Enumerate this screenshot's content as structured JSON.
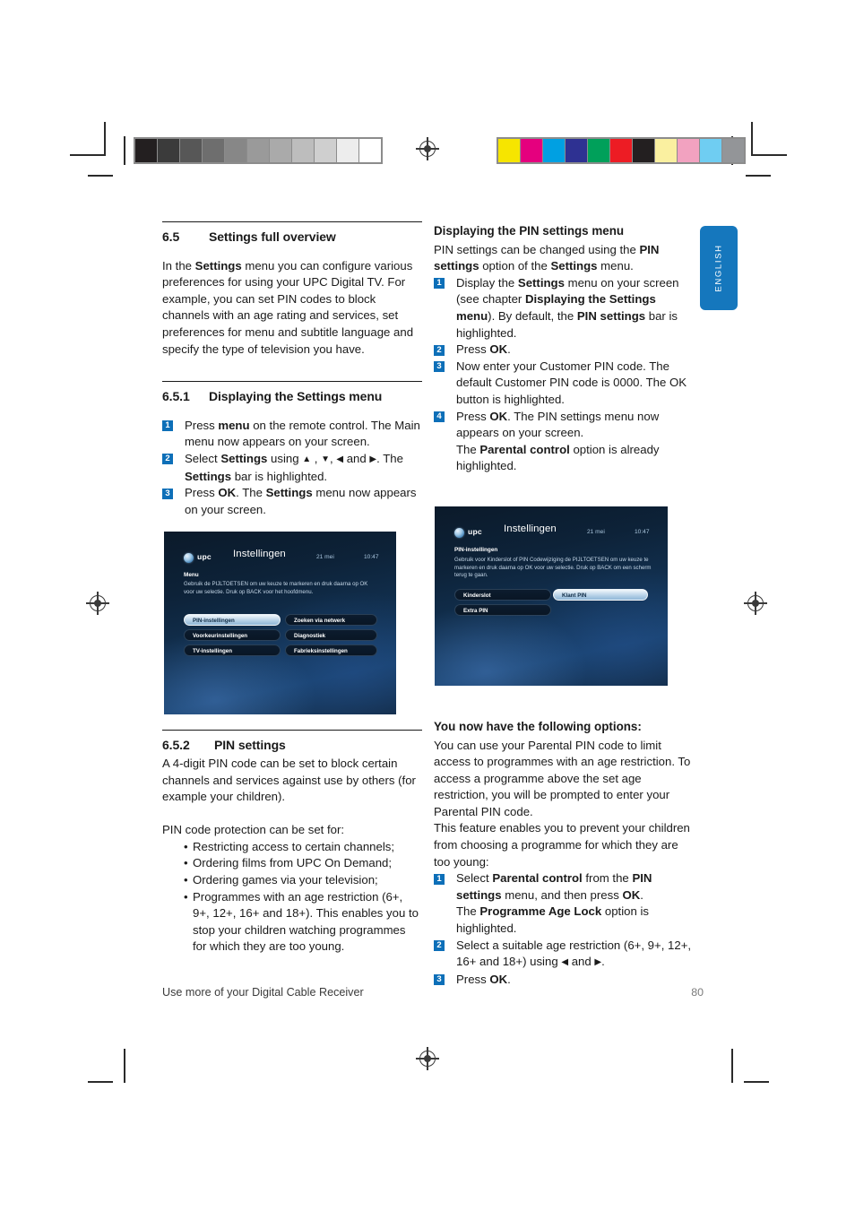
{
  "page": {
    "footer_text": "Use more of your Digital Cable Receiver",
    "page_number": "80",
    "side_tab_label": "ENGLISH",
    "accent_color": "#0d6fb8",
    "side_tab_color": "#1577bd"
  },
  "gray_bar": [
    "#231f20",
    "#3b3b3b",
    "#575757",
    "#6e6e6e",
    "#878787",
    "#9a9a9a",
    "#aaaaaa",
    "#bdbdbd",
    "#cfcfcf",
    "#ededed",
    "#ffffff"
  ],
  "color_bar": [
    "#f6e500",
    "#e5007e",
    "#00a0e2",
    "#2e3192",
    "#00a05a",
    "#ed1c24",
    "#231f20",
    "#faf0a0",
    "#f2a2c0",
    "#6fcdf2",
    "#939598"
  ],
  "left_column": {
    "section": {
      "number": "6.5",
      "title": "Settings full overview",
      "intro_html": "In the <b>Settings</b> menu you can configure various preferences for using your UPC Digital TV. For example, you can set PIN codes to block channels with an age rating and services, set preferences for menu and subtitle language and specify the type of television you have."
    },
    "subsection_1": {
      "number": "6.5.1",
      "title": "Displaying the Settings menu",
      "steps": [
        {
          "num": "1",
          "html": "Press <b>menu</b> on the remote control. The Main menu now appears on your screen."
        },
        {
          "num": "2",
          "html": "Select <b>Settings</b> using <span class=\"arrow\">▲</span> , <span class=\"arrow\">▼</span>, <span class=\"arrow\">◀</span> and <span class=\"arrow\">▶</span>. The <b>Settings</b> bar is highlighted."
        },
        {
          "num": "3",
          "html": "Press <b>OK</b>. The <b>Settings</b> menu now appears on your screen."
        }
      ]
    },
    "subsection_2": {
      "number": "6.5.2",
      "title": "PIN settings",
      "intro": "A 4-digit PIN code can be set to block certain channels and services against use by others (for example your children).",
      "lead_in": "PIN code protection can be set for:",
      "bullets": [
        "Restricting access to certain channels;",
        "Ordering films from UPC On Demand;",
        "Ordering games via your television;",
        "Programmes with an age restriction (6+, 9+, 12+, 16+ and 18+). This enables you to stop your children watching programmes for which they are too young."
      ]
    }
  },
  "right_column": {
    "heading": "Displaying the PIN settings menu",
    "intro_html": "PIN settings can be changed using the <b>PIN settings</b> option of the <b>Settings</b> menu.",
    "steps": [
      {
        "num": "1",
        "html": "Display the <b>Settings</b> menu on your screen (see chapter <b>Displaying the Settings menu</b>). By default, the <b>PIN settings</b> bar is highlighted."
      },
      {
        "num": "2",
        "html": "Press <b>OK</b>."
      },
      {
        "num": "3",
        "html": "Now enter your Customer PIN code. The default Customer PIN code is 0000. The OK button is highlighted."
      },
      {
        "num": "4",
        "html": "Press <b>OK</b>. The PIN settings menu now appears on your screen.<br>The <b>Parental control</b> option is already highlighted."
      }
    ],
    "options_heading": "You now have the following options:",
    "options_intro": "You can use your Parental PIN code to limit access to programmes with an age restriction. To access a programme above the set age restriction, you will be prompted to enter your Parental PIN code.",
    "options_intro_2": "This feature enables you to prevent your children from choosing a programme for which they are too young:",
    "options_steps": [
      {
        "num": "1",
        "html": "Select <b>Parental control</b> from the <b>PIN settings</b> menu, and then press <b>OK</b>.<br>The <b>Programme Age Lock</b> option is highlighted."
      },
      {
        "num": "2",
        "html": "Select a suitable age restriction (6+, 9+, 12+, 16+ and 18+) using <span class=\"arrow\">◀</span> and <span class=\"arrow\">▶</span>."
      },
      {
        "num": "3",
        "html": "Press <b>OK</b>."
      }
    ]
  },
  "tv_screenshot_1": {
    "logo_text": "upc",
    "title": "Instellingen",
    "date": "21 mei",
    "time": "10:47",
    "section_label": "Menu",
    "description": "Gebruik de PIJLTOETSEN om uw keuze te markeren en druk daarna op OK voor uw selectie. Druk op BACK voor het hoofdmenu.",
    "buttons_left": [
      {
        "label": "PIN-instellingen",
        "selected": true
      },
      {
        "label": "Voorkeurinstellingen",
        "selected": false
      },
      {
        "label": "TV-instellingen",
        "selected": false
      }
    ],
    "buttons_right": [
      {
        "label": "Zoeken via netwerk",
        "selected": false
      },
      {
        "label": "Diagnostiek",
        "selected": false
      },
      {
        "label": "Fabrieksinstellingen",
        "selected": false
      }
    ]
  },
  "tv_screenshot_2": {
    "logo_text": "upc",
    "title": "Instellingen",
    "date": "21 mei",
    "time": "10:47",
    "section_label": "PIN-instellingen",
    "description": "Gebruik voor Kinderslot of PIN Codewijziging de PIJLTOETSEN om uw keuze te markeren en druk daarna op OK voor uw selectie. Druk op BACK om een scherm terug te gaan.",
    "buttons_left": [
      {
        "label": "Kinderslot",
        "selected": false
      },
      {
        "label": "Extra PIN",
        "selected": false
      }
    ],
    "buttons_right": [
      {
        "label": "Klant PIN",
        "selected": true
      }
    ]
  }
}
